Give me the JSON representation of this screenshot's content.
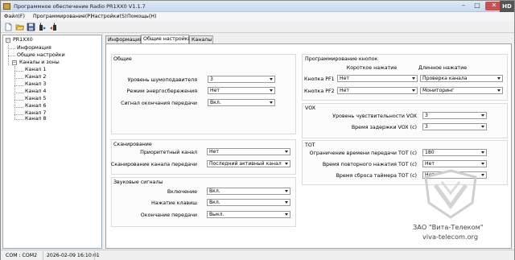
{
  "window": {
    "title": "Программное обеспечение Radio PR1XX0  V1.1.7",
    "hd_badge": "HD",
    "min_glyph": "–",
    "max_glyph": "□",
    "close_glyph": "✕"
  },
  "menu": [
    "Файл(F)",
    "Программирование(P)",
    "Настройки(S)",
    "Помощь(H)"
  ],
  "toolbar": {
    "buttons": [
      "new-file-icon",
      "open-folder-icon",
      "save-icon",
      "read-radio-icon",
      "write-radio-icon"
    ]
  },
  "tree": {
    "root": "PR1XX0",
    "items": [
      "Информация",
      "Общие настройки",
      "Каналы и зоны"
    ],
    "channels": [
      "Канал 1",
      "Канал 2",
      "Канал 3",
      "Канал 4",
      "Канал 5",
      "Канал 6",
      "Канал 7",
      "Канал 8"
    ],
    "expand_glyph": "−"
  },
  "tabs": [
    "Информация",
    "Общие настройки",
    "Каналы"
  ],
  "general": {
    "title": "Общие",
    "squelch_label": "Уровень шумоподавителя",
    "squelch_value": "3",
    "power_save_label": "Режим энергосбережения",
    "power_save_value": "Нет",
    "end_tone_label": "Сигнал окончания передачи",
    "end_tone_value": "Вкл."
  },
  "scan": {
    "title": "Сканирование",
    "priority_label": "Приоритетный канал",
    "priority_value": "Нет",
    "scan_tx_label": "Сканирование канала передачи",
    "scan_tx_value": "Последний активный канал"
  },
  "sounds": {
    "title": "Звуковые сигналы",
    "power_on_label": "Включение",
    "power_on_value": "Вкл.",
    "keypress_label": "Нажатие клавиш",
    "keypress_value": "Вкл.",
    "tx_end_label": "Окончание передачи",
    "tx_end_value": "Выкл."
  },
  "keys": {
    "title": "Программирование кнопок",
    "short_header": "Короткое нажатие",
    "long_header": "Длинное нажатие",
    "pf1_label": "Кнопка PF1",
    "pf1_short": "Нет",
    "pf1_long": "Проверка канала",
    "pf2_label": "Кнопка PF2",
    "pf2_short": "Нет",
    "pf2_long": "Мониторинг"
  },
  "vox": {
    "title": "VOX",
    "level_label": "Уровень чувствительности VOX",
    "level_value": "3",
    "delay_label": "Время задержки VOX (с)",
    "delay_value": "3"
  },
  "tot": {
    "title": "ТОТ",
    "limit_label": "Ограничение времени передачи TOT (с)",
    "limit_value": "180",
    "repeat_label": "Время повторного нажатия TOT (с)",
    "repeat_value": "Нет",
    "reset_label": "Время сброса таймера TOT (с)",
    "reset_value": "Нет"
  },
  "branding": {
    "company": "ЗАО \"Вита-Телеком\"",
    "website": "viva-telecom.org"
  },
  "status": {
    "port": "COM : COM2",
    "datetime": "2026-02-09 16:10:01"
  }
}
